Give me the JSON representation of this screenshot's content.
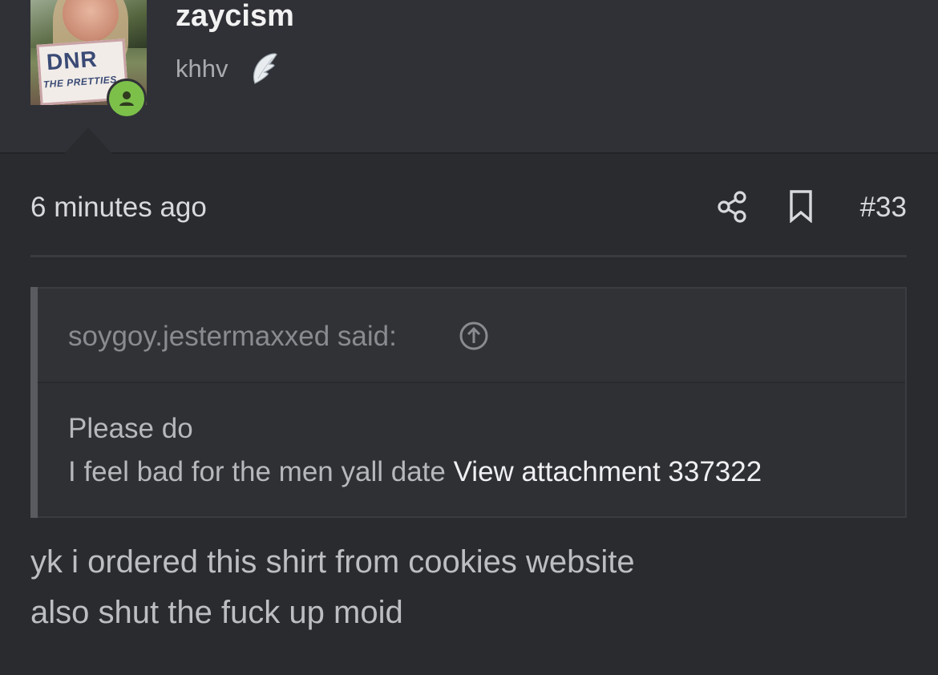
{
  "user": {
    "name": "zaycism",
    "title": "khhv",
    "avatar_sign_big": "DNR",
    "avatar_sign_small": "THE PRETTIES",
    "status_color": "#7cc04a"
  },
  "post": {
    "timestamp": "6 minutes ago",
    "number": "#33",
    "icons": [
      "share-icon",
      "bookmark-icon"
    ]
  },
  "quote": {
    "author": "soygoy.jestermaxxed said:",
    "line1": "Please do",
    "line2": "I feel bad for the men yall date",
    "attachment_link": "View attachment 337322"
  },
  "message": {
    "line1": "yk i ordered this shirt from cookies website",
    "line2": "also shut the fuck up moid"
  }
}
